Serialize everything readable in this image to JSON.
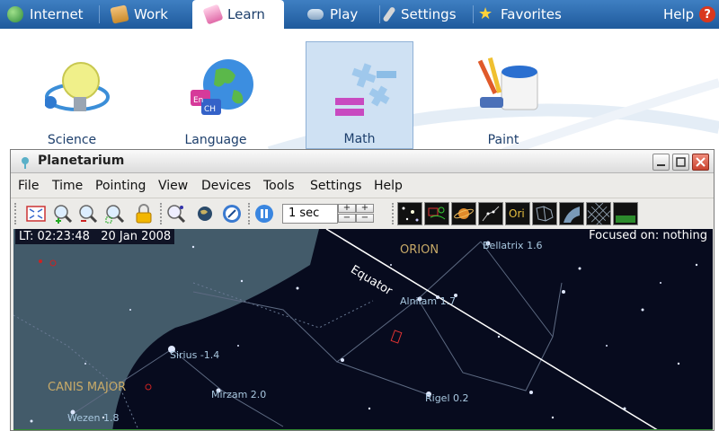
{
  "top_tabs": [
    {
      "label": "Internet"
    },
    {
      "label": "Work"
    },
    {
      "label": "Learn"
    },
    {
      "label": "Play"
    },
    {
      "label": "Settings"
    },
    {
      "label": "Favorites"
    }
  ],
  "help": {
    "label": "Help",
    "icon": "?"
  },
  "launcher": {
    "apps": [
      {
        "label": "Science"
      },
      {
        "label": "Language"
      },
      {
        "label": "Math"
      },
      {
        "label": "Paint"
      }
    ]
  },
  "window": {
    "title": "Planetarium",
    "menus": [
      "File",
      "Time",
      "Pointing",
      "View",
      "Devices",
      "Tools",
      "Settings",
      "Help"
    ],
    "toolbar": {
      "time_step": "1 sec",
      "ori_label": "Ori"
    }
  },
  "sky": {
    "local_time": "LT: 02:23:48   20 Jan 2008",
    "focus": "Focused on: nothing",
    "equator_label": "Equator",
    "constellations": [
      {
        "label": "ORION"
      },
      {
        "label": "CANIS MAJOR"
      }
    ],
    "stars": [
      {
        "label": "Bellatrix 1.6"
      },
      {
        "label": "Alnilam 1.7"
      },
      {
        "label": "Sirius -1.4"
      },
      {
        "label": "Mirzam 2.0"
      },
      {
        "label": "Rigel 0.2"
      },
      {
        "label": "Wezen 1.8"
      }
    ]
  },
  "colors": {
    "topbar": "#2a6aae",
    "sky": "#070b1e",
    "land": "#4a6472",
    "equator": "#ffffff",
    "constellation_label": "#c8aa68",
    "star_label": "#a9c8e0"
  }
}
